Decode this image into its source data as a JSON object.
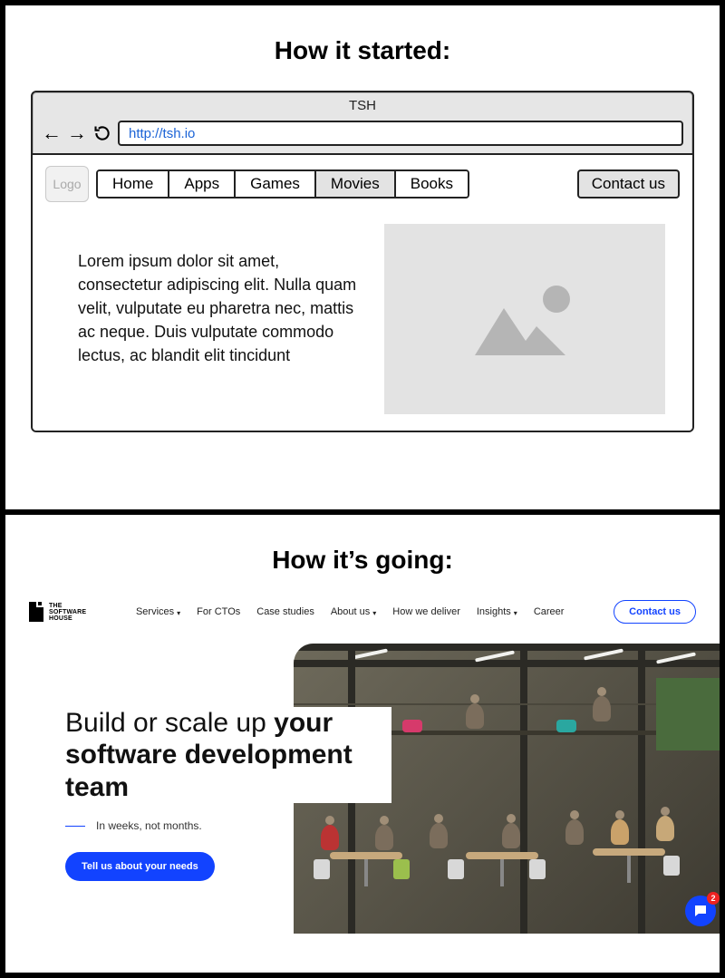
{
  "top": {
    "heading": "How it started:",
    "browser": {
      "title": "TSH",
      "url": "http://tsh.io",
      "logo_label": "Logo",
      "tabs": [
        {
          "label": "Home",
          "active": false
        },
        {
          "label": "Apps",
          "active": false
        },
        {
          "label": "Games",
          "active": false
        },
        {
          "label": "Movies",
          "active": true
        },
        {
          "label": "Books",
          "active": false
        }
      ],
      "contact_label": "Contact us",
      "body_text": "Lorem ipsum dolor sit amet, consectetur adipiscing elit. Nulla quam velit, vulputate eu pharetra nec, mattis ac neque. Duis vulputate commodo lectus, ac blandit elit tincidunt"
    }
  },
  "bottom": {
    "heading": "How it’s going:",
    "logo_text_lines": [
      "THE",
      "SOFTWARE",
      "HOUSE"
    ],
    "nav": [
      {
        "label": "Services",
        "dropdown": true
      },
      {
        "label": "For CTOs",
        "dropdown": false
      },
      {
        "label": "Case studies",
        "dropdown": false
      },
      {
        "label": "About us",
        "dropdown": true
      },
      {
        "label": "How we deliver",
        "dropdown": false
      },
      {
        "label": "Insights",
        "dropdown": true
      },
      {
        "label": "Career",
        "dropdown": false
      }
    ],
    "header_cta": "Contact us",
    "hero": {
      "title_plain": "Build or scale up ",
      "title_bold": "your software development team",
      "subtitle": "In weeks, not months.",
      "button": "Tell us about your needs"
    },
    "chat_badge": "2",
    "colors": {
      "primary": "#1243ff",
      "badge": "#e22"
    }
  }
}
